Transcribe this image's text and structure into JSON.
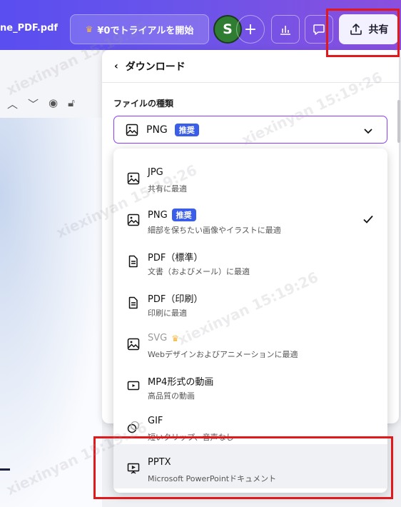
{
  "topbar": {
    "filename": "ne_PDF.pdf",
    "trial_label": "¥0でトライアルを開始",
    "avatar_letter": "S",
    "share_label": "共有"
  },
  "panel": {
    "title": "ダウンロード",
    "file_type_label": "ファイルの種類",
    "selected_format": "PNG",
    "recommended_badge": "推奨"
  },
  "options": [
    {
      "label": "JPG",
      "desc": "共有に最適",
      "icon": "image-icon"
    },
    {
      "label": "PNG",
      "desc": "細部を保ちたい画像やイラストに最適",
      "icon": "image-icon",
      "badge": "推奨",
      "selected": true
    },
    {
      "label": "PDF（標準）",
      "desc": "文書（およびメール）に最適",
      "icon": "document-icon"
    },
    {
      "label": "PDF（印刷）",
      "desc": "印刷に最適",
      "icon": "document-icon"
    },
    {
      "label": "SVG",
      "desc": "Webデザインおよびアニメーションに最適",
      "icon": "image-icon",
      "premium": true
    },
    {
      "label": "MP4形式の動画",
      "desc": "高品質の動画",
      "icon": "video-icon"
    },
    {
      "label": "GIF",
      "desc": "短いクリップ、音声なし",
      "icon": "gif-icon"
    },
    {
      "label": "PPTX",
      "desc": "Microsoft PowerPointドキュメント",
      "icon": "presentation-icon",
      "highlighted": true
    }
  ],
  "watermark_text": "xiexinyan 15:19:26",
  "colors": {
    "accent": "#8b3dff",
    "badge": "#3b5ee8",
    "annotation": "#e1191d"
  }
}
